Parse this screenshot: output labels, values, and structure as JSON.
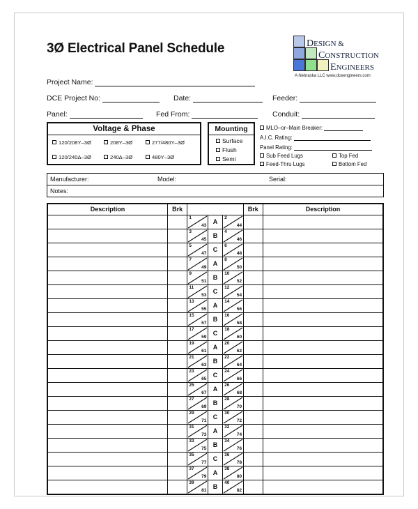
{
  "document": {
    "title": "3Ø Electrical Panel Schedule"
  },
  "logo": {
    "word1_cap": "D",
    "word1_rest": "ESIGN &",
    "word2_cap": "C",
    "word2_rest": "ONSTRUCTION",
    "word3_cap": "E",
    "word3_rest": "NGINEERS",
    "tagline": "A  Nebraska LLC    www.dceengineers.com",
    "colors": {
      "sq_r1c1": "#b9c8e8",
      "sq_r2c1": "#8fa8e0",
      "sq_r2c2": "#c2e8c0",
      "sq_r3c1": "#4a76d8",
      "sq_r3c2": "#8fe08c",
      "sq_r3c3": "#f2f2c0"
    }
  },
  "project_fields": {
    "project_name": "Project Name:",
    "dce_project_no": "DCE Project No:",
    "date": "Date:",
    "feeder": "Feeder:",
    "panel": "Panel:",
    "fed_from": "Fed From:",
    "conduit": "Conduit:"
  },
  "voltage_phase": {
    "header": "Voltage & Phase",
    "options": [
      "120/208Y–3Ø",
      "208Y–3Ø",
      "277/480Y–3Ø",
      "120/240Δ–3Ø",
      "240Δ–3Ø",
      "480Y–3Ø"
    ]
  },
  "mounting": {
    "header": "Mounting",
    "options": [
      "Surface",
      "Flush",
      "Semi"
    ]
  },
  "panel_details": {
    "mlo_main_breaker": "MLO–or–Main Breaker:",
    "aic_rating": "A.I.C. Rating:",
    "panel_rating": "Panel Rating:",
    "sub_feed_lugs": "Sub Feed Lugs",
    "top_fed": "Top Fed",
    "feed_thru_lugs": "Feed-Thru Lugs",
    "bottom_fed": "Bottom Fed"
  },
  "equipment": {
    "manufacturer": "Manufacturer:",
    "model": "Model:",
    "serial": "Serial:",
    "notes": "Notes:"
  },
  "schedule": {
    "headers": {
      "description_left": "Description",
      "brk_left": "Brk",
      "circuit": "",
      "brk_right": "Brk",
      "description_right": "Description"
    },
    "rows": [
      {
        "left_top": "1",
        "left_bottom": "43",
        "phase": "A",
        "right_top": "2",
        "right_bottom": "44"
      },
      {
        "left_top": "3",
        "left_bottom": "45",
        "phase": "B",
        "right_top": "4",
        "right_bottom": "46"
      },
      {
        "left_top": "5",
        "left_bottom": "47",
        "phase": "C",
        "right_top": "6",
        "right_bottom": "48"
      },
      {
        "left_top": "7",
        "left_bottom": "49",
        "phase": "A",
        "right_top": "8",
        "right_bottom": "50"
      },
      {
        "left_top": "9",
        "left_bottom": "51",
        "phase": "B",
        "right_top": "10",
        "right_bottom": "52"
      },
      {
        "left_top": "11",
        "left_bottom": "53",
        "phase": "C",
        "right_top": "12",
        "right_bottom": "54"
      },
      {
        "left_top": "13",
        "left_bottom": "55",
        "phase": "A",
        "right_top": "14",
        "right_bottom": "56"
      },
      {
        "left_top": "15",
        "left_bottom": "57",
        "phase": "B",
        "right_top": "16",
        "right_bottom": "58"
      },
      {
        "left_top": "17",
        "left_bottom": "59",
        "phase": "C",
        "right_top": "18",
        "right_bottom": "60"
      },
      {
        "left_top": "19",
        "left_bottom": "61",
        "phase": "A",
        "right_top": "20",
        "right_bottom": "62"
      },
      {
        "left_top": "21",
        "left_bottom": "63",
        "phase": "B",
        "right_top": "22",
        "right_bottom": "64"
      },
      {
        "left_top": "23",
        "left_bottom": "65",
        "phase": "C",
        "right_top": "24",
        "right_bottom": "66"
      },
      {
        "left_top": "25",
        "left_bottom": "67",
        "phase": "A",
        "right_top": "26",
        "right_bottom": "68"
      },
      {
        "left_top": "27",
        "left_bottom": "69",
        "phase": "B",
        "right_top": "28",
        "right_bottom": "70"
      },
      {
        "left_top": "29",
        "left_bottom": "71",
        "phase": "C",
        "right_top": "30",
        "right_bottom": "72"
      },
      {
        "left_top": "31",
        "left_bottom": "73",
        "phase": "A",
        "right_top": "32",
        "right_bottom": "74"
      },
      {
        "left_top": "33",
        "left_bottom": "75",
        "phase": "B",
        "right_top": "34",
        "right_bottom": "76"
      },
      {
        "left_top": "35",
        "left_bottom": "77",
        "phase": "C",
        "right_top": "36",
        "right_bottom": "78"
      },
      {
        "left_top": "37",
        "left_bottom": "79",
        "phase": "A",
        "right_top": "38",
        "right_bottom": "80"
      },
      {
        "left_top": "39",
        "left_bottom": "81",
        "phase": "B",
        "right_top": "40",
        "right_bottom": "82"
      }
    ]
  }
}
